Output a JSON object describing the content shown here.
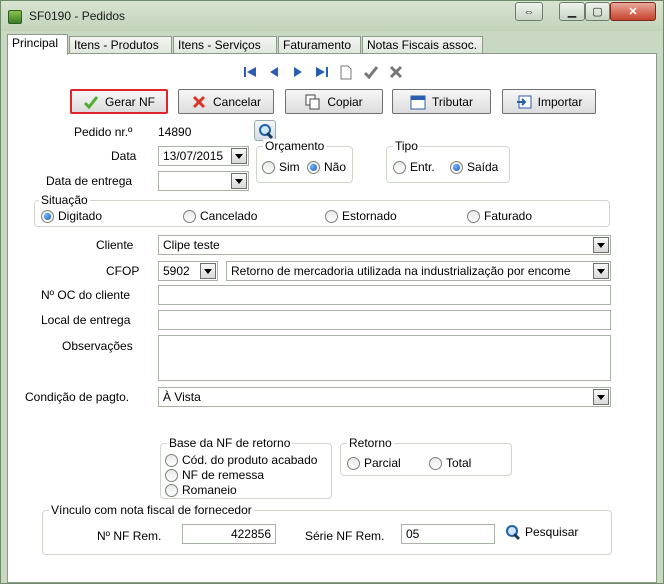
{
  "window": {
    "title": "SF0190 - Pedidos"
  },
  "tabs": [
    "Principal",
    "Itens - Produtos",
    "Itens - Serviços",
    "Faturamento",
    "Notas Fiscais assoc."
  ],
  "toolbar": {
    "gerar_nf": "Gerar NF",
    "cancelar": "Cancelar",
    "copiar": "Copiar",
    "tributar": "Tributar",
    "importar": "Importar"
  },
  "form": {
    "pedido_label": "Pedido nr.º",
    "pedido_value": "14890",
    "data_label": "Data",
    "data_value": "13/07/2015",
    "data_entrega_label": "Data de entrega",
    "data_entrega_value": "",
    "orcamento": {
      "title": "Orçamento",
      "sim": "Sim",
      "nao": "Não",
      "selected": "Não"
    },
    "tipo": {
      "title": "Tipo",
      "entr": "Entr.",
      "saida": "Saída",
      "selected": "Saída"
    },
    "situacao": {
      "title": "Situação",
      "options": [
        "Digitado",
        "Cancelado",
        "Estornado",
        "Faturado"
      ],
      "selected": "Digitado"
    },
    "cliente_label": "Cliente",
    "cliente_value": "Clipe teste",
    "cfop_label": "CFOP",
    "cfop_code": "5902",
    "cfop_desc": "Retorno de mercadoria utilizada na industrialização por encome",
    "oc_label": "Nº OC do cliente",
    "oc_value": "",
    "local_label": "Local de entrega",
    "local_value": "",
    "obs_label": "Observações",
    "obs_value": "",
    "cond_label": "Condição de pagto.",
    "cond_value": "À Vista",
    "base_nf": {
      "title": "Base da NF de retorno",
      "options": [
        "Cód. do produto acabado",
        "NF de remessa",
        "Romaneio"
      ]
    },
    "retorno": {
      "title": "Retorno",
      "parcial": "Parcial",
      "total": "Total"
    },
    "vinculo": {
      "title": "Vínculo com nota fiscal de fornecedor",
      "nf_rem_label": "Nº NF Rem.",
      "nf_rem_value": "422856",
      "serie_label": "Série NF Rem.",
      "serie_value": "05",
      "pesquisar": "Pesquisar"
    }
  },
  "colors": {
    "highlight": "#e0242b",
    "window_bg": "#c9d8c2",
    "nav_blue": "#2a5fb0"
  }
}
